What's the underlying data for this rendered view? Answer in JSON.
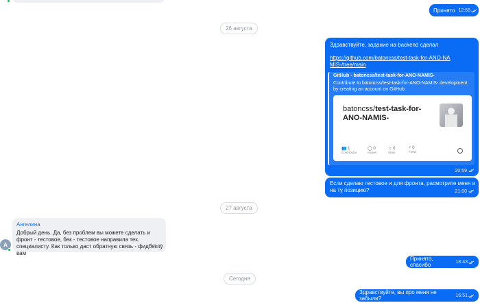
{
  "messages": {
    "m1": {
      "text": "Принято",
      "time": "12:58"
    },
    "date1": "26 августа",
    "m2": {
      "text": "Здравствуйте, задание на backend сделал",
      "link": "https://github.com/batoncss/test-task-for-ANO-NAMIS-/tree/main",
      "preview": {
        "title": "GitHub - batoncss/test-task-for-ANO-NAMIS-",
        "description": "Contribute to batoncss/test-task-for-ANO-NAMIS- development by creating an account on GitHub.",
        "repo_owner": "batoncss/",
        "repo_name": "test-task-for-ANO-NAMIS-",
        "stats": [
          {
            "icon": "contributors-icon",
            "value": "1",
            "label": "Contributor"
          },
          {
            "icon": "issues-icon",
            "value": "0",
            "label": "Issues"
          },
          {
            "icon": "stars-icon",
            "value": "0",
            "label": "Stars"
          },
          {
            "icon": "forks-icon",
            "value": "0",
            "label": "Forks"
          }
        ]
      },
      "time": "20:59"
    },
    "m3": {
      "text": "Если сделаю тестовое и для фронта, расмотрите меня и на ту позицию?",
      "time": "21:00"
    },
    "date2": "27 августа",
    "m4": {
      "author": "Ангелина",
      "avatar_letter": "А",
      "text": "Добрый день. Да, без проблем вы можете сделать и фронт - тестовое, бек - тестовое направила тех. специалисту. Как только даст обратную связь - фидбекну вам",
      "time": "18:42"
    },
    "m5": {
      "text": "Принято, спасибо",
      "time": "18:43"
    },
    "date3": "Сегодня",
    "m6": {
      "text": "Здравствуйте, вы про меня не забыли?",
      "time": "16:51"
    }
  },
  "colors": {
    "outgoing": "#0a6cf5",
    "incoming": "#eef0f3",
    "author": "#1a73e8",
    "online": "#21b24b"
  }
}
